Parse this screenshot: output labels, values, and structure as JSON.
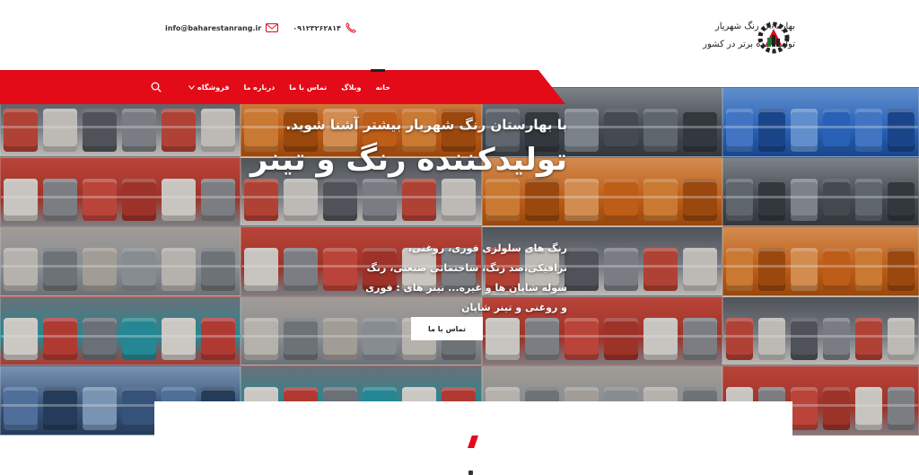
{
  "header": {
    "brand_name": "بهارستان رنگ شهریار",
    "brand_tagline": "تولید کننده برتر در کشور",
    "email": "info@baharestanrang.ir",
    "phone": "۰۹۱۲۳۲۶۲۸۱۴",
    "icons": {
      "email": "mail-icon",
      "phone": "phone-icon",
      "logo": "gear-factory-logo"
    }
  },
  "nav": {
    "items": [
      {
        "label": "خانه",
        "active": true
      },
      {
        "label": "وبلاگ"
      },
      {
        "label": "تماس با ما"
      },
      {
        "label": "درباره ما"
      },
      {
        "label": "فروشگاه",
        "has_dropdown": true
      }
    ],
    "search_icon": "search-icon",
    "accent_color": "#e30b17"
  },
  "hero": {
    "subtitle": "با بهارستان رنگ شهریار بیشتر آشنا شوید.",
    "title": "تولیدکننده رنگ و تینر",
    "description": "رنگ های سلولزی فوری، روغنی، ترافیکی،ضد زنگ، ساختمانی صنعتی، رنگ سوله شاپان ها و غیره... تینر های : فوری و روغنی و تینر شاپان",
    "cta_label": "تماس با ما"
  }
}
